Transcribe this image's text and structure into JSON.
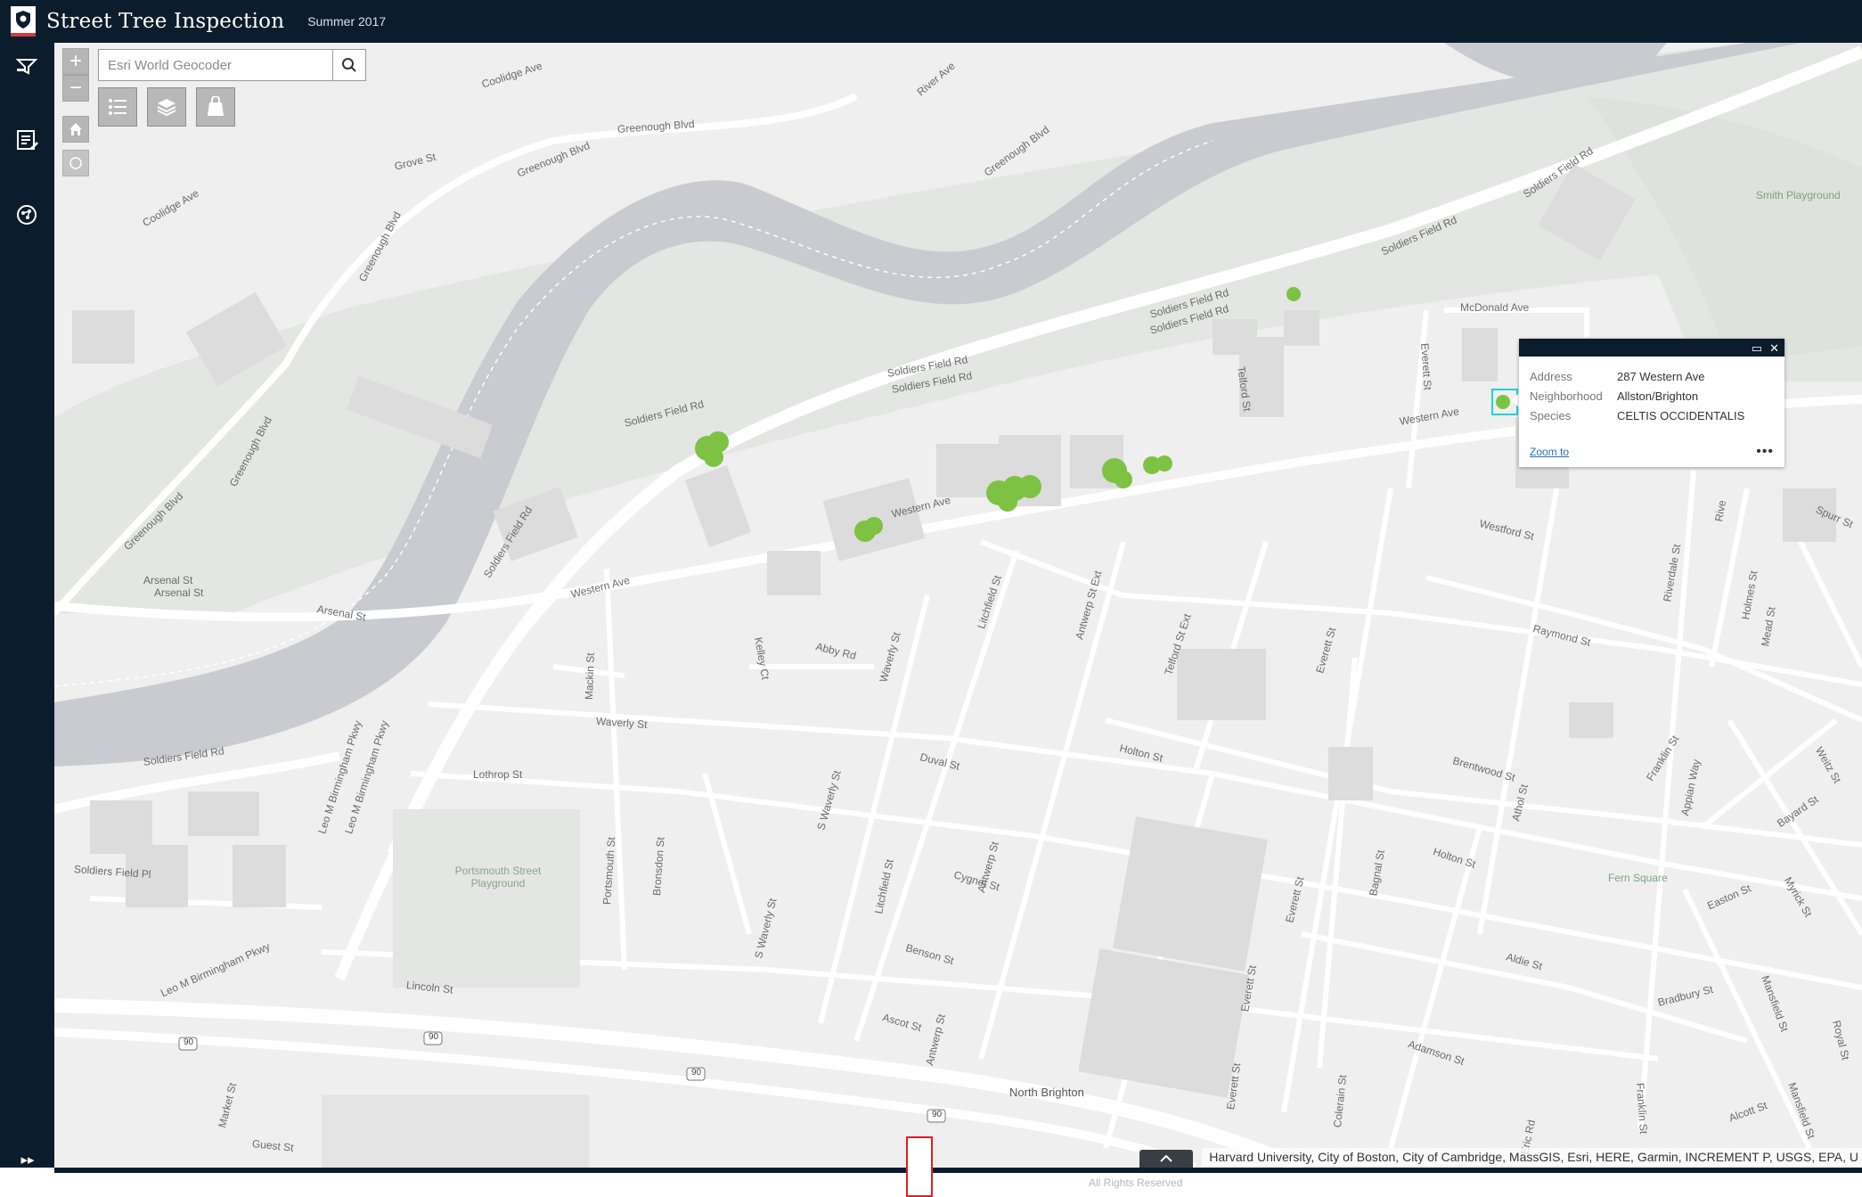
{
  "header": {
    "title": "Street Tree Inspection",
    "subtitle": "Summer 2017"
  },
  "colors": {
    "header_bg": "#0b1d2c",
    "map_bg": "#efefef",
    "water": "#c9cbd0",
    "park": "#e1e5e1",
    "road": "#ffffff",
    "tree": "#7dc242",
    "selection": "#20d2e0"
  },
  "sidebar": {
    "items": [
      {
        "name": "filter-icon"
      },
      {
        "name": "edit-list-icon"
      },
      {
        "name": "compass-icon"
      }
    ],
    "expand_glyph": "▸▸"
  },
  "map_widgets": {
    "zoom_in": "+",
    "zoom_out": "−",
    "search_placeholder": "Esri World Geocoder",
    "tools": [
      "list-icon",
      "layers-icon",
      "basemap-icon"
    ]
  },
  "popup": {
    "fields": [
      {
        "label": "Address",
        "value": "287 Western Ave"
      },
      {
        "label": "Neighborhood",
        "value": "Allston/Brighton"
      },
      {
        "label": "Species",
        "value": "CELTIS OCCIDENTALIS"
      }
    ],
    "zoom_to": "Zoom to",
    "more": "•••"
  },
  "labels": {
    "soldiers_field_rd": "Soldiers Field Rd",
    "western_ave": "Western Ave",
    "greenough_blvd": "Greenough Blvd",
    "arsenal_st": "Arsenal St",
    "mcdonald_ave": "McDonald Ave",
    "everett_st": "Everett St",
    "telford_st": "Telford St",
    "telford_st_ext": "Telford St Ext",
    "raymond_st": "Raymond St",
    "westford_st": "Westford St",
    "holton_st": "Holton St",
    "brentwood_st": "Brentwood St",
    "waverly_st": "Waverly St",
    "s_waverly_st": "S Waverly St",
    "duval_st": "Duval St",
    "abby_rd": "Abby Rd",
    "litchfield_st": "Litchfield St",
    "antwerp_st": "Antwerp St",
    "antwerp_st_ext": "Antwerp St Ext",
    "cygnet_st": "Cygnet St",
    "benson_st": "Benson St",
    "ascot_st": "Ascot St",
    "lothrop_st": "Lothrop St",
    "mackin_st": "Mackin St",
    "kelley_ct": "Kelley Ct",
    "lincoln_st": "Lincoln St",
    "portsmouth_st": "Portsmouth St",
    "bronsdon_st": "Bronsdon St",
    "soldiers_field_pl": "Soldiers Field Pl",
    "leo_birmingham": "Leo M Birmingham Pkwy",
    "grove_st": "Grove St",
    "coolidge_ave": "Coolidge Ave",
    "river_ave": "River Ave",
    "north_brighton": "North Brighton",
    "guest_st": "Guest St",
    "market_st": "Market St",
    "adamson_st": "Adamson St",
    "aldie_st": "Aldie St",
    "easton_st": "Easton St",
    "bradbury_st": "Bradbury St",
    "franklin_st": "Franklin St",
    "mansfield_st": "Mansfield St",
    "royal_st": "Royal St",
    "bagnal_st": "Bagnal St",
    "eric_rd": "Eric Rd",
    "colerain_st": "Colerain St",
    "alcott_st": "Alcott St",
    "appian_way": "Appian Way",
    "bayard_st": "Bayard St",
    "myrick_st": "Myrick St",
    "riverdale_st": "Riverdale St",
    "holmes_st": "Holmes St",
    "mead_st": "Mead St",
    "athol_st": "Athol St",
    "spurr_st": "Spurr St",
    "weitz_st": "Weitz St",
    "rive_prefix": "Rive",
    "fern_square": "Fern Square",
    "smith_playground": "Smith Playground",
    "portsmouth_playground": "Portsmouth Street Playground",
    "i90": "90"
  },
  "attribution": "Harvard University, City of Boston, City of Cambridge, MassGIS, Esri, HERE, Garmin, INCREMENT P, USGS, EPA, U",
  "footer": "All Rights Reserved"
}
